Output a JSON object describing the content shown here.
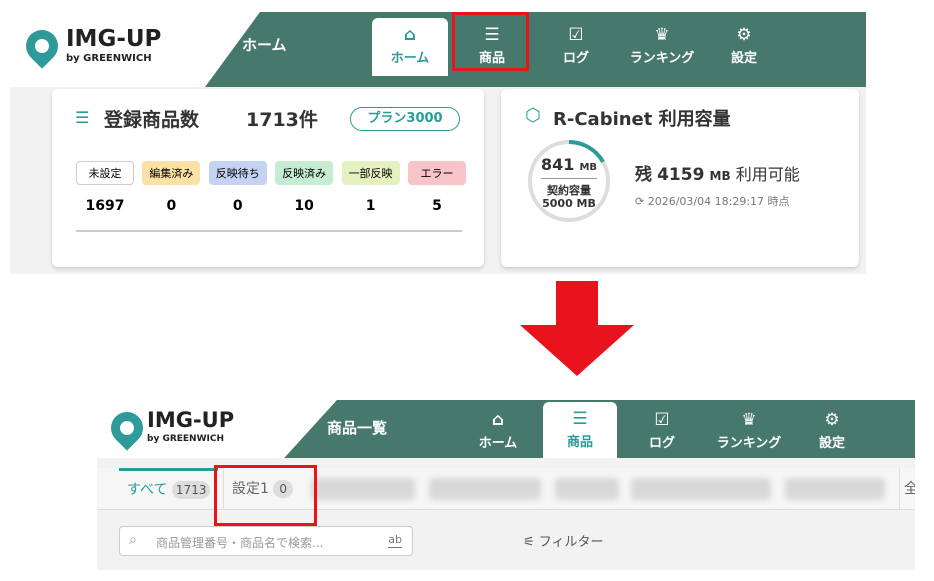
{
  "top": {
    "logo": {
      "name": "IMG-UP",
      "sub": "by GREENWICH"
    },
    "page_title": "ホーム",
    "nav": [
      {
        "icon": "home-icon",
        "glyph": "⌂",
        "label": "ホーム"
      },
      {
        "icon": "list-icon",
        "glyph": "☰",
        "label": "商品"
      },
      {
        "icon": "checkbox-icon",
        "glyph": "☑",
        "label": "ログ"
      },
      {
        "icon": "crown-icon",
        "glyph": "♛",
        "label": "ランキング"
      },
      {
        "icon": "gear-icon",
        "glyph": "⚙",
        "label": "設定"
      }
    ],
    "products_card": {
      "title": "登録商品数",
      "count": "1713件",
      "plan": "プラン3000",
      "statuses": [
        {
          "label": "未設定",
          "value": "1697",
          "color": "#ffffff"
        },
        {
          "label": "編集済み",
          "value": "0",
          "color": "#fbe1a6"
        },
        {
          "label": "反映待ち",
          "value": "0",
          "color": "#c5d3f3"
        },
        {
          "label": "反映済み",
          "value": "10",
          "color": "#c6ecd2"
        },
        {
          "label": "一部反映",
          "value": "1",
          "color": "#e6f1c2"
        },
        {
          "label": "エラー",
          "value": "5",
          "color": "#f8c4c8"
        }
      ]
    },
    "cabinet_card": {
      "title": "R-Cabinet 利用容量",
      "used": "841",
      "used_unit": "MB",
      "contract_label": "契約容量",
      "contract": "5000 MB",
      "remain_prefix": "残",
      "remain": "4159",
      "remain_unit": "MB",
      "remain_suffix": "利用可能",
      "timestamp": "2026/03/04 18:29:17 時点",
      "used_fraction": 0.168
    }
  },
  "bottom": {
    "logo": {
      "name": "IMG-UP",
      "sub": "by GREENWICH"
    },
    "page_title": "商品一覧",
    "nav": [
      {
        "icon": "home-icon",
        "glyph": "⌂",
        "label": "ホーム"
      },
      {
        "icon": "list-icon",
        "glyph": "☰",
        "label": "商品"
      },
      {
        "icon": "checkbox-icon",
        "glyph": "☑",
        "label": "ログ"
      },
      {
        "icon": "crown-icon",
        "glyph": "♛",
        "label": "ランキング"
      },
      {
        "icon": "gear-icon",
        "glyph": "⚙",
        "label": "設定"
      }
    ],
    "tabs": [
      {
        "label": "すべて",
        "count": "1713"
      },
      {
        "label": "設定1",
        "count": "0"
      }
    ],
    "tab_overflow": "全",
    "search_placeholder": "商品管理番号・商品名で検索...",
    "search_suffix": "ab",
    "filter_label": "フィルター"
  },
  "colors": {
    "header": "#46796c",
    "accent": "#2a9c97",
    "highlight": "#e8131c",
    "arrow": "#e8131c"
  }
}
